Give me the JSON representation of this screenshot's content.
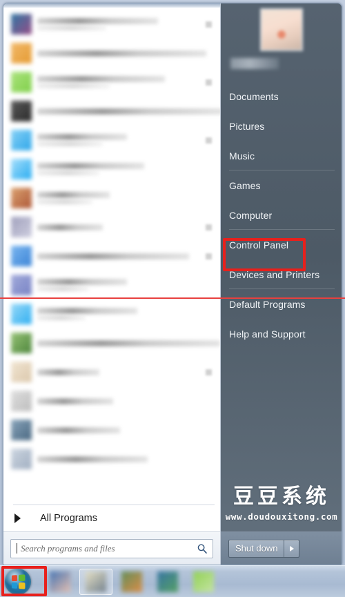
{
  "window": {
    "title": "Windows 7 Start Menu",
    "accent_panel_color": "#4d5a66",
    "annotation_color": "#e8201c"
  },
  "left_panel": {
    "programs": [
      {
        "icon_color": "#8c3f7d",
        "icon_color2": "#1f6b9c",
        "label_width": 175,
        "sub_width": 100,
        "has_arrow": true
      },
      {
        "icon_color": "#e49322",
        "icon_color2": "#f0b35d",
        "label_width": 245,
        "sub_width": 0,
        "has_arrow": false
      },
      {
        "icon_color": "#76cc3c",
        "icon_color2": "#a4e072",
        "label_width": 185,
        "sub_width": 105,
        "has_arrow": true
      },
      {
        "icon_color": "#1a1a1a",
        "icon_color2": "#4b4b4b",
        "label_width": 270,
        "sub_width": 0,
        "has_arrow": false
      },
      {
        "icon_color": "#1ea0e8",
        "icon_color2": "#7ccdf5",
        "label_width": 130,
        "sub_width": 95,
        "has_arrow": true
      },
      {
        "icon_color": "#18a6f0",
        "icon_color2": "#9fdcfb",
        "label_width": 155,
        "sub_width": 90,
        "has_arrow": false
      },
      {
        "icon_color": "#a84a28",
        "icon_color2": "#d79a63",
        "label_width": 105,
        "sub_width": 80,
        "has_arrow": false
      },
      {
        "icon_color": "#c9c9dc",
        "icon_color2": "#9a9ab8",
        "label_width": 95,
        "sub_width": 0,
        "has_arrow": true
      },
      {
        "icon_color": "#2d7bd4",
        "icon_color2": "#6fb0ee",
        "label_width": 220,
        "sub_width": 0,
        "has_arrow": true
      },
      {
        "icon_color": "#6d79c0",
        "icon_color2": "#9aa3d8",
        "label_width": 130,
        "sub_width": 75,
        "has_arrow": false
      },
      {
        "icon_color": "#20a9f0",
        "icon_color2": "#8fd6f8",
        "label_width": 145,
        "sub_width": 70,
        "has_arrow": false
      },
      {
        "icon_color": "#3f7c2c",
        "icon_color2": "#8dbd6a",
        "label_width": 265,
        "sub_width": 0,
        "has_arrow": false
      },
      {
        "icon_color": "#d9c4a6",
        "icon_color2": "#efe2cd",
        "label_width": 90,
        "sub_width": 0,
        "has_arrow": true
      },
      {
        "icon_color": "#b8b8b8",
        "icon_color2": "#dcdcdc",
        "label_width": 110,
        "sub_width": 0,
        "has_arrow": false
      },
      {
        "icon_color": "#3b5c78",
        "icon_color2": "#7f9cb4",
        "label_width": 120,
        "sub_width": 0,
        "has_arrow": false
      },
      {
        "icon_color": "#9aa9bd",
        "icon_color2": "#c8d2de",
        "label_width": 160,
        "sub_width": 0,
        "has_arrow": false
      }
    ],
    "all_programs_label": "All Programs",
    "all_programs_icon": "chevron-right-icon",
    "search": {
      "placeholder": "Search programs and files",
      "value": "",
      "icon": "search-icon"
    }
  },
  "right_panel": {
    "user": {
      "avatar": "user-avatar-picture",
      "name": ""
    },
    "places": [
      {
        "label": "Documents",
        "separator_after": false
      },
      {
        "label": "Pictures",
        "separator_after": false
      },
      {
        "label": "Music",
        "separator_after": true
      },
      {
        "label": "Games",
        "separator_after": false
      },
      {
        "label": "Computer",
        "separator_after": true
      },
      {
        "label": "Control Panel",
        "separator_after": false,
        "highlighted": true
      },
      {
        "label": "Devices and Printers",
        "separator_after": true
      },
      {
        "label": "Default Programs",
        "separator_after": false
      },
      {
        "label": "Help and Support",
        "separator_after": false
      }
    ],
    "shutdown": {
      "label": "Shut down",
      "arrow_icon": "chevron-right-icon"
    }
  },
  "watermark": {
    "brand": "豆豆系统",
    "url": "www.doudouxitong.com"
  },
  "taskbar": {
    "start_orb": "windows-start-orb-icon",
    "items": [
      {
        "icon_color": "#3f6fb0",
        "icon_color2": "#e9bfae",
        "open": false
      },
      {
        "icon_color": "#e8e2c4",
        "icon_color2": "#6d7b87",
        "open": true
      },
      {
        "icon_color": "#5d8a4e",
        "icon_color2": "#e08a3c",
        "open": false
      },
      {
        "icon_color": "#2d6f9e",
        "icon_color2": "#4f9e5c",
        "open": false
      },
      {
        "icon_color": "#8fd34a",
        "icon_color2": "#c8e8a0",
        "open": false
      }
    ]
  },
  "annotations": {
    "control_panel_box": "red-highlight-box-control-panel",
    "start_orb_box": "red-highlight-box-start-orb",
    "horizontal_line": "red-horizontal-guide-line"
  }
}
